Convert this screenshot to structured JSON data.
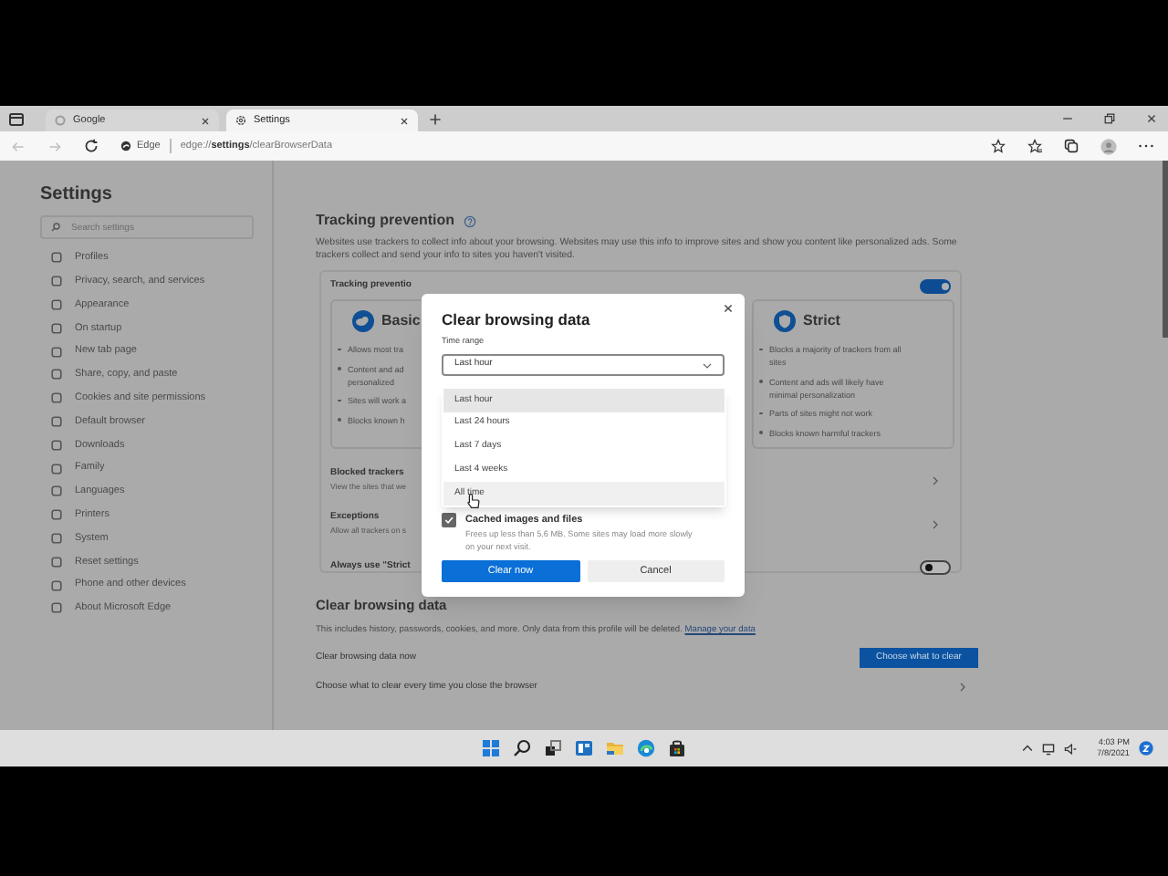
{
  "browser": {
    "tabs": [
      {
        "title": "Google",
        "kind": "web",
        "selected": false
      },
      {
        "title": "Settings",
        "kind": "settings",
        "selected": true
      }
    ],
    "address": {
      "badge": "Edge",
      "url": "edge://**settings**/clearBrowserData"
    }
  },
  "sidebar": {
    "title": "Settings",
    "search_placeholder": "Search settings",
    "items": [
      "Profiles",
      "Privacy, search, and services",
      "Appearance",
      "On startup",
      "New tab page",
      "Share, copy, and paste",
      "Cookies and site permissions",
      "Default browser",
      "Downloads",
      "Family",
      "Languages",
      "Printers",
      "System",
      "Reset settings",
      "Phone and other devices",
      "About Microsoft Edge"
    ]
  },
  "tracking": {
    "title": "Tracking prevention",
    "description": "Websites use trackers to collect info about your browsing. Websites may use this info to improve sites and show you content like personalized ads. Some trackers collect and send your info to sites you haven't visited.",
    "panel_label": "Tracking preventio",
    "on": true,
    "cards": [
      {
        "title": "Basic",
        "kind": "basic",
        "bullets": [
          [
            "Allows most tra"
          ],
          [
            "Content and ad",
            "personalized"
          ],
          [
            "Sites will work a"
          ],
          [
            "Blocks known h"
          ]
        ]
      },
      {
        "title": "Strict",
        "kind": "strict",
        "bullets": [
          [
            "Blocks a majority of trackers from all",
            "sites"
          ],
          [
            "Content and ads will likely have",
            "minimal personalization"
          ],
          [
            "Parts of sites might not work"
          ],
          [
            "Blocks known harmful trackers"
          ]
        ]
      }
    ],
    "rows": [
      {
        "kind": "link",
        "title": "Blocked trackers",
        "subtitle": "View the sites that we"
      },
      {
        "kind": "link",
        "title": "Exceptions",
        "subtitle": "Allow all trackers on s"
      },
      {
        "kind": "toggle",
        "title": "Always use \"Strict",
        "on": false
      }
    ]
  },
  "clear_section": {
    "title": "Clear browsing data",
    "description": "This includes history, passwords, cookies, and more. Only data from this profile will be deleted.",
    "link": "Manage your data",
    "rows": [
      {
        "kind": "button",
        "label": "Clear browsing data now",
        "button": "Choose what to clear"
      },
      {
        "kind": "link",
        "label": "Choose what to clear every time you close the browser"
      }
    ]
  },
  "dialog": {
    "title": "Clear browsing data",
    "time_range_label": "Time range",
    "time_range_value": "Last hour",
    "options": [
      {
        "label": "Last hour",
        "selected": true,
        "hovered": false
      },
      {
        "label": "Last 24 hours",
        "selected": false,
        "hovered": false
      },
      {
        "label": "Last 7 days",
        "selected": false,
        "hovered": false
      },
      {
        "label": "Last 4 weeks",
        "selected": false,
        "hovered": false
      },
      {
        "label": "All time",
        "selected": false,
        "hovered": true
      }
    ],
    "checkbox": {
      "label": "Cached images and files",
      "checked": true,
      "note": "Frees up less than 5.6 MB. Some sites may load more slowly on your next visit."
    },
    "buttons": [
      {
        "label": "Clear now",
        "kind": "primary"
      },
      {
        "label": "Cancel",
        "kind": "secondary"
      }
    ]
  },
  "taskbar": {
    "time": "4:03 PM",
    "date": "7/8/2021"
  }
}
